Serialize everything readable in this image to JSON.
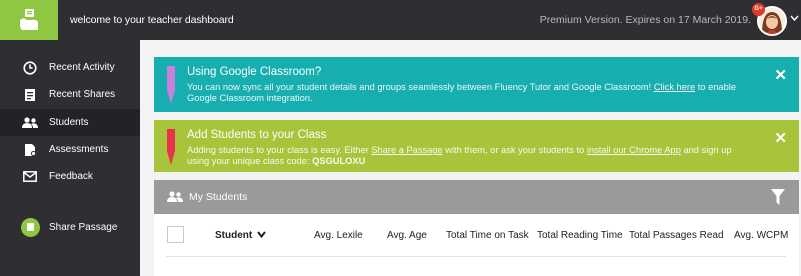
{
  "header": {
    "welcome": "welcome to your teacher dashboard",
    "premium": "Premium Version. Expires on 17 March 2019.",
    "avatar_badge": "G+",
    "logo_icon": "hand-book-icon",
    "chevron_icon": "chevron-down-icon"
  },
  "sidebar": {
    "items": [
      {
        "label": "Recent Activity",
        "icon": "clock-icon",
        "active": false
      },
      {
        "label": "Recent Shares",
        "icon": "share-doc-icon",
        "active": false
      },
      {
        "label": "Students",
        "icon": "users-icon",
        "active": true
      },
      {
        "label": "Assessments",
        "icon": "assessment-icon",
        "active": false
      },
      {
        "label": "Feedback",
        "icon": "mail-icon",
        "active": false
      }
    ],
    "share_label": "Share Passage"
  },
  "banners": {
    "classroom": {
      "title": "Using Google Classroom?",
      "body_pre": "You can now sync all your student details and groups seamlessly between Fluency Tutor and Google Classroom! ",
      "link": "Click here",
      "body_post": " to enable Google Classroom integration.",
      "close": "✕",
      "color": "#17aeb0"
    },
    "add_students": {
      "title": "Add Students to your Class",
      "body_pre": "Adding students to your class is easy. Either ",
      "link1": "Share a Passage",
      "body_mid": " with them, or ask your students to ",
      "link2": "install our Chrome App",
      "body_post": " and sign up using your unique class code: ",
      "class_code": "QSGULOXU",
      "close": "✕",
      "color": "#a8c43a"
    }
  },
  "students_panel": {
    "title": "My Students",
    "columns": [
      "Student",
      "Avg. Lexile",
      "Avg. Age",
      "Total Time on Task",
      "Total Reading Time",
      "Total Passages Read",
      "Avg. WCPM"
    ],
    "sort_icon": "chevron-down-icon",
    "filter_icon": "filter-icon"
  },
  "colors": {
    "brand_green": "#8fc742",
    "dark_bg": "#2e2e33"
  }
}
